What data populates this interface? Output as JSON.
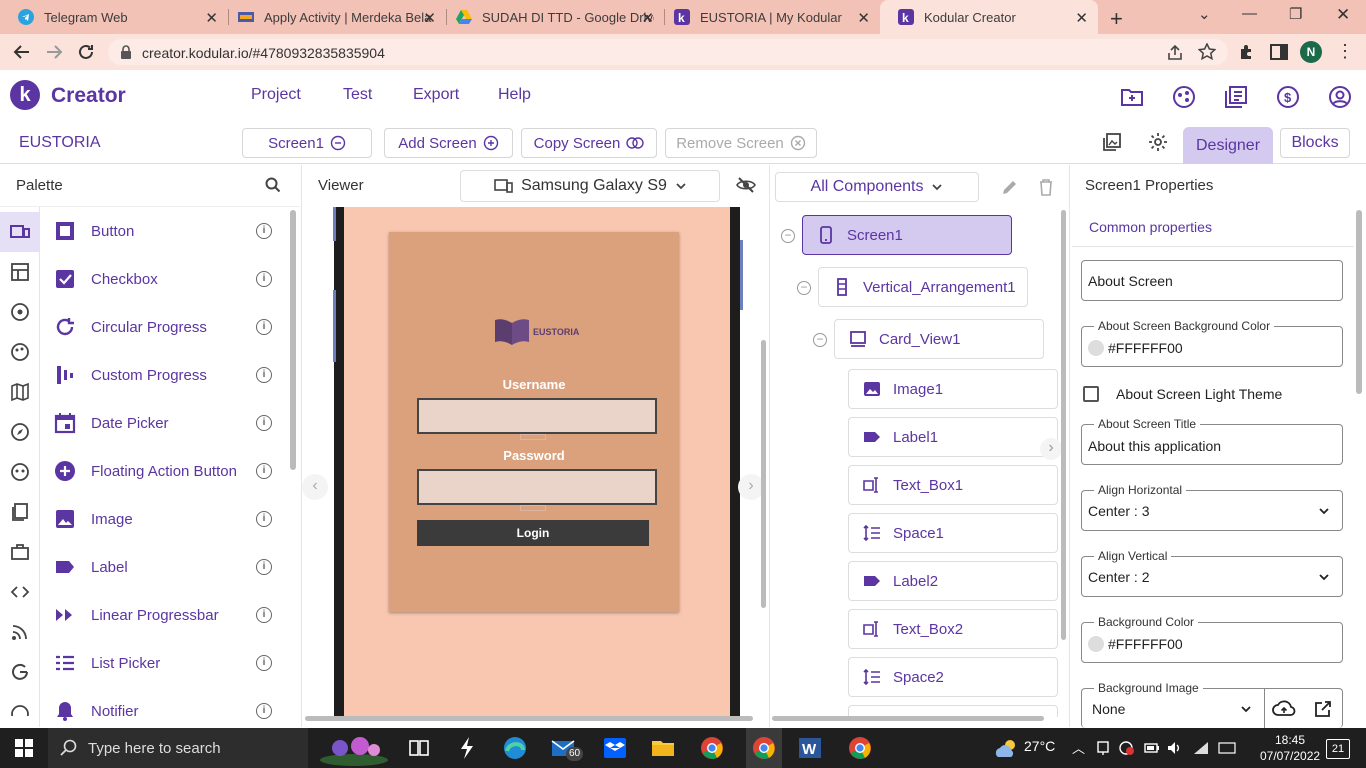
{
  "browser": {
    "tabs": [
      {
        "title": "Telegram Web",
        "icon": "telegram-icon"
      },
      {
        "title": "Apply Activity | Merdeka Bela",
        "icon": "merdeka-icon"
      },
      {
        "title": "SUDAH DI TTD - Google Drive",
        "icon": "google-drive-icon"
      },
      {
        "title": "EUSTORIA | My Kodular",
        "icon": "kodular-icon"
      },
      {
        "title": "Kodular Creator",
        "icon": "kodular-icon"
      }
    ],
    "url": "creator.kodular.io/#4780932835835904",
    "profile_initial": "N"
  },
  "app": {
    "brand": "Creator",
    "logo_letter": "k",
    "menu": [
      "Project",
      "Test",
      "Export",
      "Help"
    ],
    "project_name": "EUSTORIA",
    "screen_select": "Screen1",
    "add_screen": "Add Screen",
    "copy_screen": "Copy Screen",
    "remove_screen": "Remove Screen",
    "designer_tab": "Designer",
    "blocks_tab": "Blocks"
  },
  "palette": {
    "title": "Palette",
    "items": [
      {
        "label": "Button",
        "icon": "button-icon"
      },
      {
        "label": "Checkbox",
        "icon": "checkbox-icon"
      },
      {
        "label": "Circular Progress",
        "icon": "circular-progress-icon"
      },
      {
        "label": "Custom Progress",
        "icon": "custom-progress-icon"
      },
      {
        "label": "Date Picker",
        "icon": "date-picker-icon"
      },
      {
        "label": "Floating Action Button",
        "icon": "fab-icon"
      },
      {
        "label": "Image",
        "icon": "image-icon"
      },
      {
        "label": "Label",
        "icon": "label-icon"
      },
      {
        "label": "Linear Progressbar",
        "icon": "linear-progress-icon"
      },
      {
        "label": "List Picker",
        "icon": "list-picker-icon"
      },
      {
        "label": "Notifier",
        "icon": "notifier-icon"
      }
    ]
  },
  "viewer": {
    "title": "Viewer",
    "device": "Samsung Galaxy S9",
    "app_title": "EUSTORIA",
    "username_label": "Username",
    "password_label": "Password",
    "login_label": "Login"
  },
  "components": {
    "filter": "All Components",
    "tree": [
      {
        "name": "Screen1",
        "icon": "phone-icon"
      },
      {
        "name": "Vertical_Arrangement1",
        "icon": "vertical-arrangement-icon"
      },
      {
        "name": "Card_View1",
        "icon": "card-view-icon"
      },
      {
        "name": "Image1",
        "icon": "image-icon"
      },
      {
        "name": "Label1",
        "icon": "label-icon"
      },
      {
        "name": "Text_Box1",
        "icon": "textbox-icon"
      },
      {
        "name": "Space1",
        "icon": "space-icon"
      },
      {
        "name": "Label2",
        "icon": "label-icon"
      },
      {
        "name": "Text_Box2",
        "icon": "textbox-icon"
      },
      {
        "name": "Space2",
        "icon": "space-icon"
      }
    ]
  },
  "properties": {
    "title": "Screen1 Properties",
    "section": "Common properties",
    "about_screen": "About Screen",
    "about_bg_label": "About Screen Background Color",
    "about_bg_value": "#FFFFFF00",
    "light_theme_label": "About Screen Light Theme",
    "about_title_label": "About Screen Title",
    "about_title_value": "About this application",
    "align_h_label": "Align Horizontal",
    "align_h_value": "Center : 3",
    "align_v_label": "Align Vertical",
    "align_v_value": "Center : 2",
    "bg_color_label": "Background Color",
    "bg_color_value": "#FFFFFF00",
    "bg_image_label": "Background Image",
    "bg_image_value": "None"
  },
  "taskbar": {
    "search_placeholder": "Type here to search",
    "temperature": "27°C",
    "time": "18:45",
    "date": "07/07/2022",
    "mail_badge": "60",
    "notif_badge": "21"
  },
  "colors": {
    "accent": "#5b35a2",
    "tab_bar": "#f3c2b6",
    "phone_bg": "#f9c7b0",
    "card_bg": "#dba17d"
  }
}
